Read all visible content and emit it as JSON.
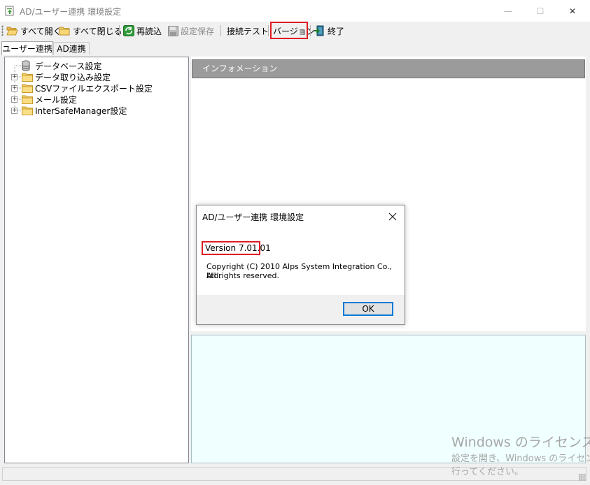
{
  "window": {
    "title": "AD/ユーザー連携 環境設定",
    "minimize_glyph": "—",
    "maximize_glyph": "☐",
    "close_glyph": "✕"
  },
  "toolbar": {
    "expand_all": "すべて開く",
    "collapse_all": "すべて閉じる",
    "reload": "再読込",
    "save": "設定保存",
    "connection_test": "接続テスト",
    "version": "バージョン",
    "exit": "終了"
  },
  "tabs": [
    {
      "label": "ユーザー連携"
    },
    {
      "label": "AD連携"
    }
  ],
  "tree": {
    "items": [
      {
        "label": "データベース設定"
      },
      {
        "label": "データ取り込み設定"
      },
      {
        "label": "CSVファイルエクスポート設定"
      },
      {
        "label": "メール設定"
      },
      {
        "label": "InterSafeManager設定"
      }
    ],
    "expander_glyph": "+"
  },
  "info_panel": {
    "header": "インフォメーション"
  },
  "dialog": {
    "title": "AD/ユーザー連携 環境設定",
    "version": "Version 7.01.01",
    "copyright": "Copyright (C) 2010 Alps System Integration Co., Ltd.",
    "rights": "All rights reserved.",
    "ok": "OK"
  },
  "watermark": {
    "line1": "Windows のライセンス認証",
    "line2": "設定を開き、Windows のライセンス認証を行ってください。",
    "line3": "行ってください。"
  },
  "colors": {
    "highlight": "#e01b24",
    "info_header_bg": "#9b9b9b",
    "bottom_panel_bg": "#f0ffff",
    "accent": "#0078d7"
  },
  "icons": {
    "app": "app-icon",
    "expand_all": "folder-open-icon",
    "collapse_all": "folder-closed-icon",
    "reload": "refresh-icon",
    "save": "floppy-disk-icon",
    "exit": "exit-door-icon",
    "database": "database-icon",
    "folder": "folder-icon"
  }
}
